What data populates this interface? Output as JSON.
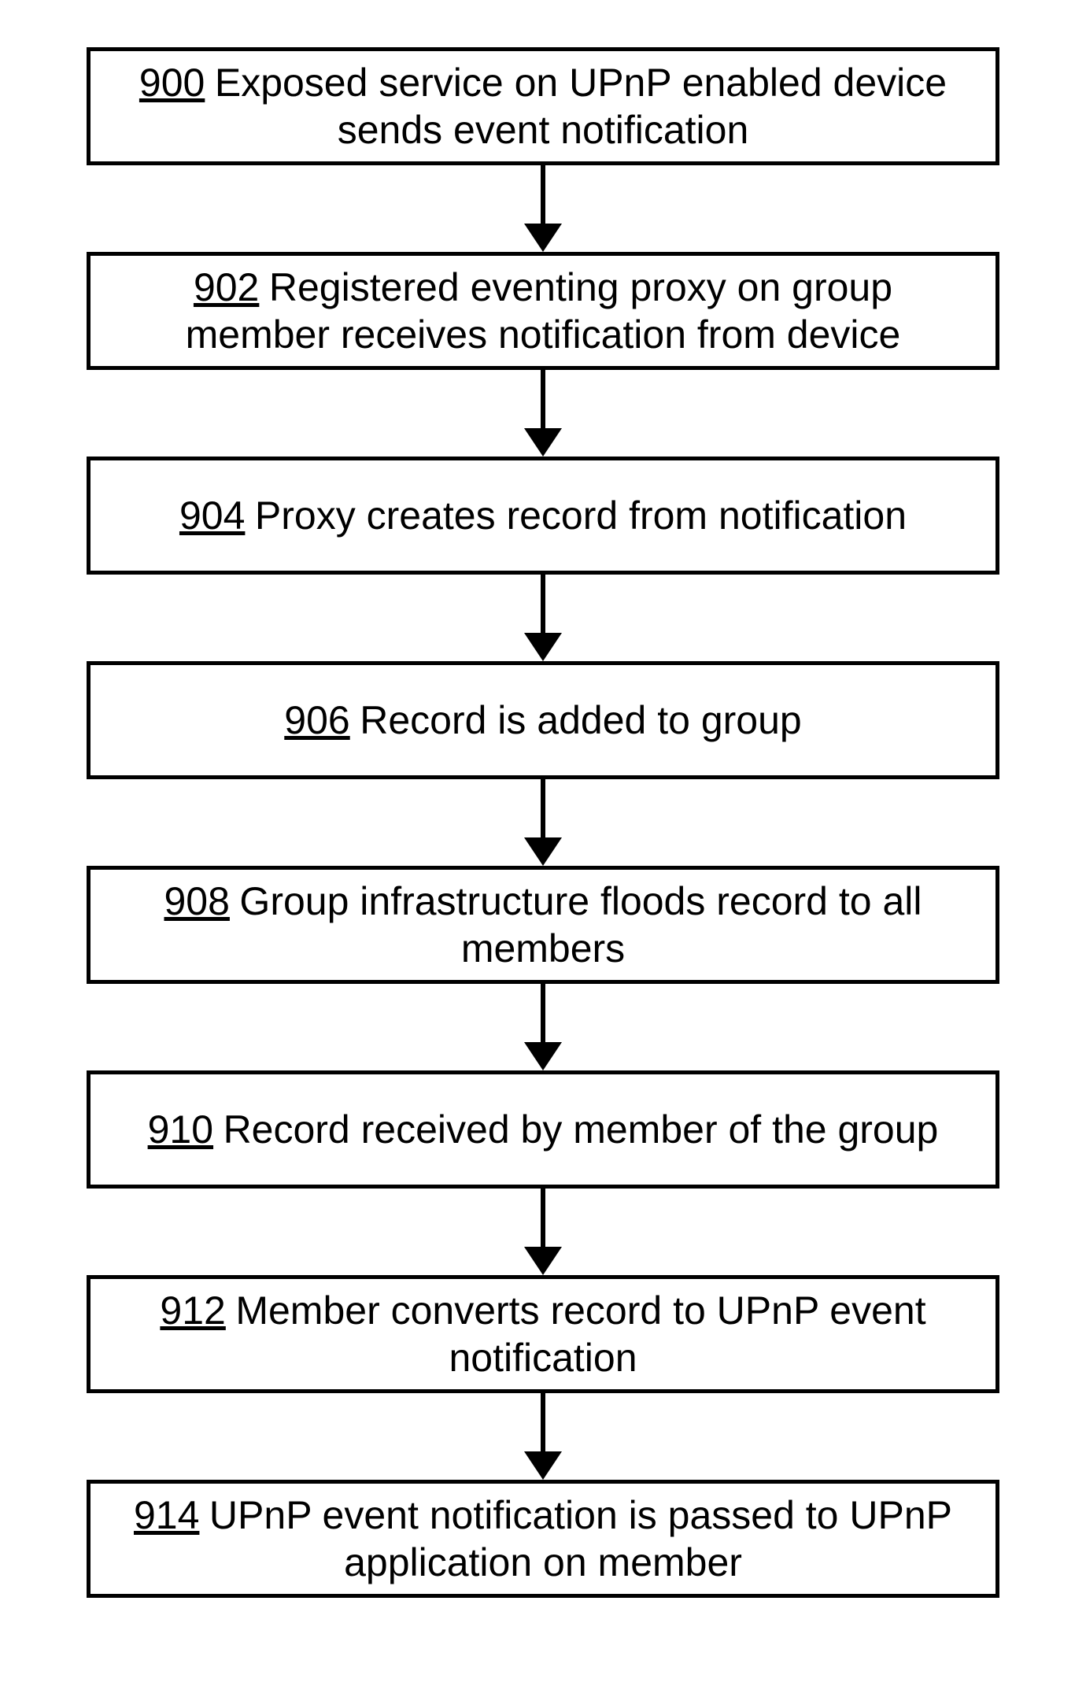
{
  "steps": [
    {
      "num": "900",
      "text": "Exposed service on UPnP enabled device sends event notification"
    },
    {
      "num": "902",
      "text": "Registered eventing proxy on group member receives notification from device"
    },
    {
      "num": "904",
      "text": "Proxy creates record from notification"
    },
    {
      "num": "906",
      "text": "Record is added to group"
    },
    {
      "num": "908",
      "text": "Group infrastructure floods record to all members"
    },
    {
      "num": "910",
      "text": "Record received by member of the group"
    },
    {
      "num": "912",
      "text": "Member converts record to UPnP event notification"
    },
    {
      "num": "914",
      "text": "UPnP event notification is passed to UPnP application on member"
    }
  ]
}
